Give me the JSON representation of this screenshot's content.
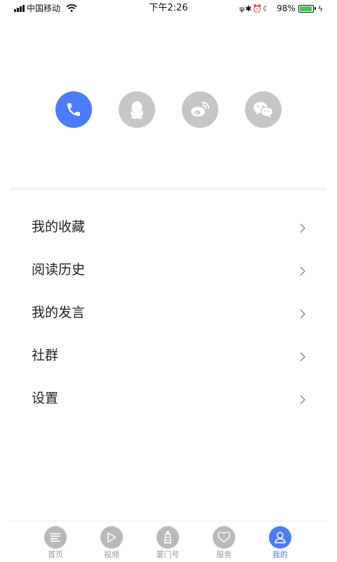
{
  "status_bar": {
    "carrier": "中国移动",
    "time": "下午2:26",
    "battery_percent": "98%",
    "battery_level": 0.98,
    "status_glyphs": "ψ✱⏰☾"
  },
  "login": {
    "methods": [
      "phone",
      "qq",
      "weibo",
      "wechat"
    ]
  },
  "menu": {
    "items": [
      {
        "label": "我的收藏"
      },
      {
        "label": "阅读历史"
      },
      {
        "label": "我的发言"
      },
      {
        "label": "社群"
      },
      {
        "label": "设置"
      }
    ]
  },
  "tabbar": {
    "items": [
      {
        "label": "首页",
        "icon": "news-icon"
      },
      {
        "label": "视频",
        "icon": "play-icon"
      },
      {
        "label": "厦门号",
        "icon": "lighthouse-icon"
      },
      {
        "label": "服务",
        "icon": "heart-icon"
      },
      {
        "label": "我的",
        "icon": "user-icon"
      }
    ],
    "active_index": 4
  },
  "colors": {
    "accent": "#4c7cfc",
    "inactive_icon": "#b9b9b9",
    "login_gray": "#c6c6c6",
    "battery_green": "#3ec94b"
  }
}
